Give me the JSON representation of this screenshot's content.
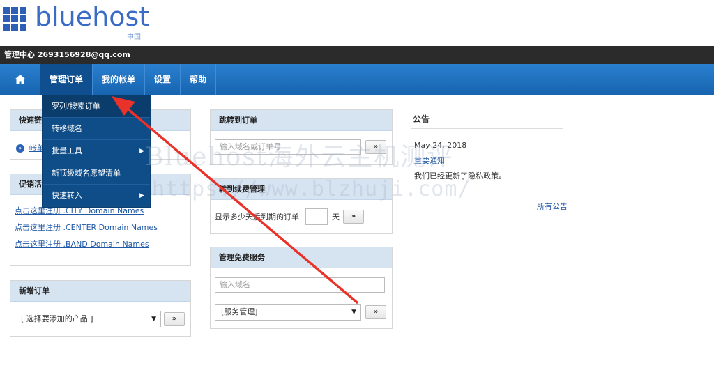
{
  "brand": {
    "name": "bluehost",
    "sub": "中国"
  },
  "account": {
    "label": "管理中心 2693156928@qq.com"
  },
  "nav": {
    "items": [
      "管理订单",
      "我的帐单",
      "设置",
      "帮助"
    ]
  },
  "dropdown": {
    "items": [
      "罗列/搜索订单",
      "转移域名",
      "批量工具",
      "新顶级域名愿望清单",
      "快速转入"
    ]
  },
  "quick_links": {
    "title": "快速链接",
    "item": "帐单"
  },
  "promo": {
    "title": "促销活动",
    "links": [
      "点击这里注册 .CITY Domain Names",
      "点击这里注册 .CENTER Domain Names",
      "点击这里注册 .BAND Domain Names"
    ]
  },
  "new_order": {
    "title": "新增订单",
    "select": "[ 选择要添加的产品 ]",
    "go": "»"
  },
  "jump": {
    "title": "跳转到订单",
    "placeholder": "输入域名或订单号",
    "go": "»"
  },
  "renew": {
    "title": "转到续费管理",
    "label": "显示多少天后到期的订单",
    "unit": "天",
    "go": "»"
  },
  "free": {
    "title": "管理免费服务",
    "placeholder": "输入域名",
    "select": "[服务管理]",
    "go": "»"
  },
  "announcement": {
    "title": "公告",
    "date": "May 24, 2018",
    "notice": "重要通知",
    "text": "我们已经更新了隐私政策。",
    "all": "所有公告"
  },
  "watermark": {
    "line1": "Bluehost海外云主机测评",
    "line2": "https://www.blzhuji.com/"
  },
  "colors": {
    "nav": "#1b6fc0",
    "dropdown": "#0e4d88",
    "panel_head": "#d6e4f2",
    "accent_arrow": "#e8322a"
  }
}
